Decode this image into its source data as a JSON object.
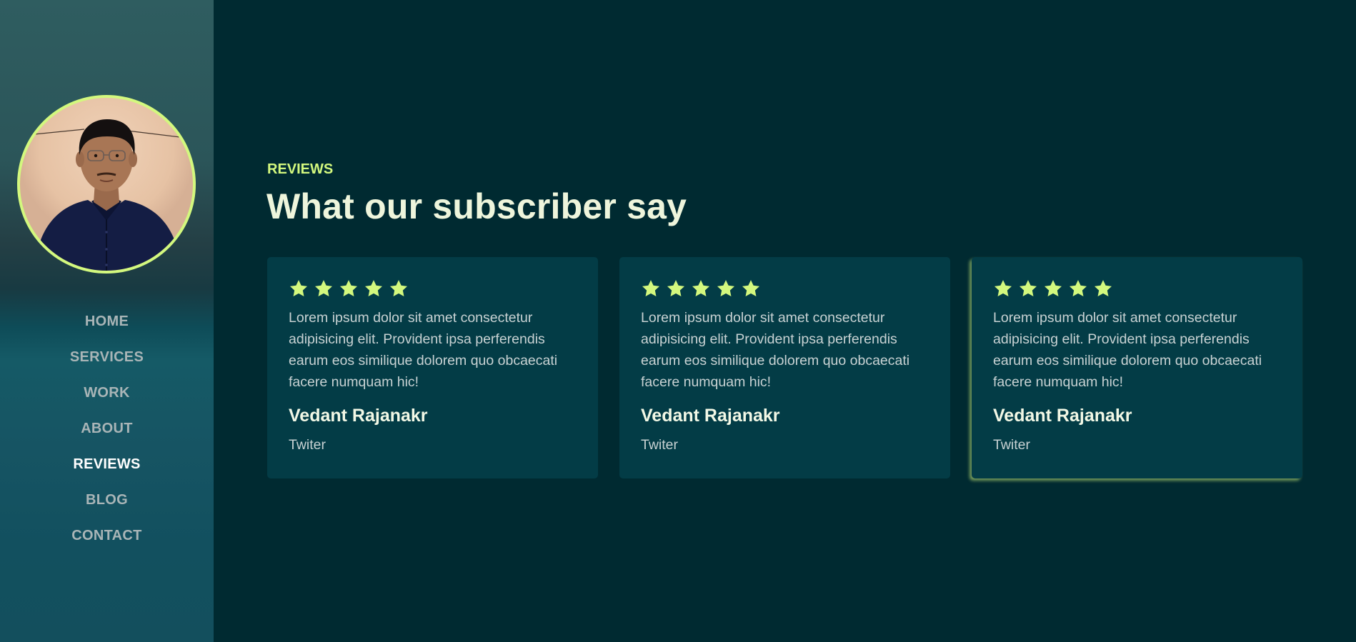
{
  "sidebar": {
    "nav": [
      {
        "label": "HOME",
        "active": false
      },
      {
        "label": "SERVICES",
        "active": false
      },
      {
        "label": "WORK",
        "active": false
      },
      {
        "label": "ABOUT",
        "active": false
      },
      {
        "label": "REVIEWS",
        "active": true
      },
      {
        "label": "BLOG",
        "active": false
      },
      {
        "label": "CONTACT",
        "active": false
      }
    ]
  },
  "section": {
    "eyebrow": "REVIEWS",
    "title": "What our subscriber say"
  },
  "reviews": [
    {
      "stars": 5,
      "text": "Lorem ipsum dolor sit amet consectetur adipisicing elit. Provident ipsa perferendis earum eos similique dolorem quo obcaecati facere numquam hic!",
      "name": "Vedant Rajanakr",
      "platform": "Twiter"
    },
    {
      "stars": 5,
      "text": "Lorem ipsum dolor sit amet consectetur adipisicing elit. Provident ipsa perferendis earum eos similique dolorem quo obcaecati facere numquam hic!",
      "name": "Vedant Rajanakr",
      "platform": "Twiter"
    },
    {
      "stars": 5,
      "text": "Lorem ipsum dolor sit amet consectetur adipisicing elit. Provident ipsa perferendis earum eos similique dolorem quo obcaecati facere numquam hic!",
      "name": "Vedant Rajanakr",
      "platform": "Twiter"
    }
  ],
  "colors": {
    "accent": "#d3f87e",
    "background": "#002a31",
    "card": "#033c46",
    "heading": "#eef5dc"
  },
  "icons": {
    "star": "star-icon"
  }
}
